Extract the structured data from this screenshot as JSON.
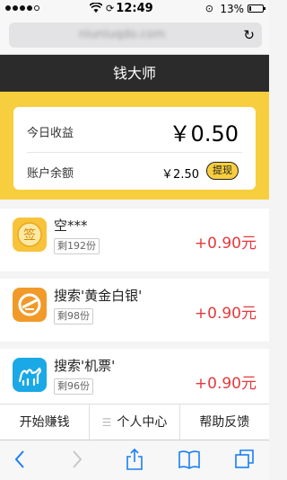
{
  "status_bar": {
    "time": "12:49",
    "battery_pct": "13%",
    "battery_level": 0.13,
    "loading_icon": "sync-icon",
    "lock_icon": "rotation-lock-icon"
  },
  "browser": {
    "url": "niuniuqdo.com"
  },
  "header": {
    "title": "钱大师"
  },
  "earnings": {
    "today_label": "今日收益",
    "today_value": "￥0.50",
    "balance_label": "账户余额",
    "balance_value": "￥2.50",
    "withdraw_label": "提现"
  },
  "tasks": [
    {
      "name": "空***",
      "remaining": "剩192份",
      "reward": "+0.90元",
      "icon": "sign-icon",
      "icon_color": "#f8c33b"
    },
    {
      "name": "搜索'黄金白银'",
      "remaining": "剩98份",
      "reward": "+0.90元",
      "icon": "gold-silver-icon",
      "icon_color": "#f19a2a"
    },
    {
      "name": "搜索'机票'",
      "remaining": "剩96份",
      "reward": "+0.90元",
      "icon": "camel-icon",
      "icon_color": "#1aa9e6"
    }
  ],
  "tabbar": {
    "tabs": [
      "开始赚钱",
      "个人中心",
      "帮助反馈"
    ]
  },
  "colors": {
    "accent_yellow": "#f7ce3e",
    "header_bg": "#2b2b2b",
    "reward_red": "#e4393c",
    "ios_blue": "#1a7ef5"
  }
}
